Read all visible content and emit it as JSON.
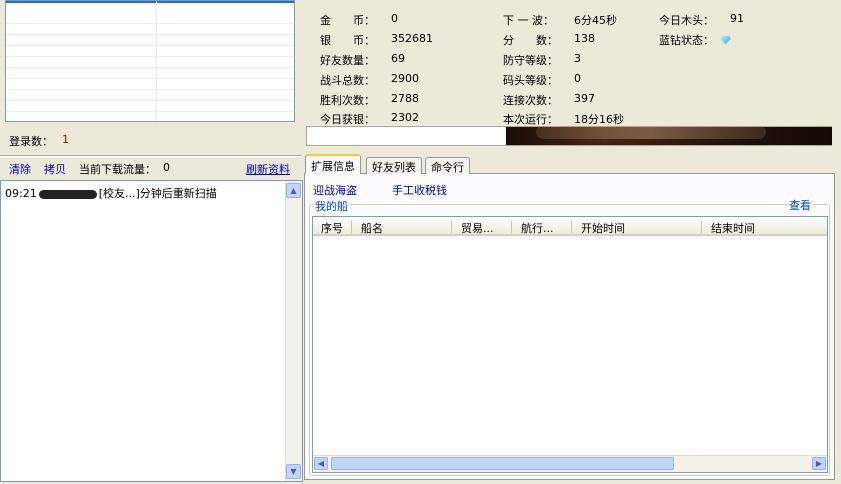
{
  "login": {
    "label": "登录数：",
    "count": "1"
  },
  "toolbar": {
    "clear": "清除",
    "copy": "拷贝",
    "download_label": "当前下载流量：",
    "download_value": "0",
    "refresh": "刷新资料"
  },
  "log": {
    "time": "09:21",
    "message": "[校友...]分钟后重新扫描"
  },
  "stats": {
    "col1": [
      {
        "label": "金　　币：",
        "value": "0"
      },
      {
        "label": "银　　币：",
        "value": "352681"
      },
      {
        "label": "好友数量：",
        "value": "69"
      },
      {
        "label": "战斗总数：",
        "value": "2900"
      },
      {
        "label": "胜利次数：",
        "value": "2788"
      },
      {
        "label": "今日获银：",
        "value": "2302"
      }
    ],
    "col2": [
      {
        "label": "下 一 波：",
        "value": "6分45秒"
      },
      {
        "label": "分　　数：",
        "value": "138"
      },
      {
        "label": "防守等级：",
        "value": "3"
      },
      {
        "label": "码头等级：",
        "value": "0"
      },
      {
        "label": "连接次数：",
        "value": "397"
      },
      {
        "label": "本次运行：",
        "value": "18分16秒"
      }
    ],
    "col3": [
      {
        "label": "今日木头：",
        "value": "91"
      },
      {
        "label": "蓝钻状态：",
        "value": ""
      }
    ]
  },
  "tabs": [
    "扩展信息",
    "好友列表",
    "命令行"
  ],
  "actions": {
    "pirate": "迎战海盗",
    "tax": "手工收税钱"
  },
  "ships": {
    "legend": "我的船",
    "view": "查看",
    "columns": [
      "序号",
      "船名",
      "贸易...",
      "航行...",
      "开始时间",
      "结束时间"
    ]
  },
  "icons": {
    "diamond": "blue-diamond-icon"
  }
}
